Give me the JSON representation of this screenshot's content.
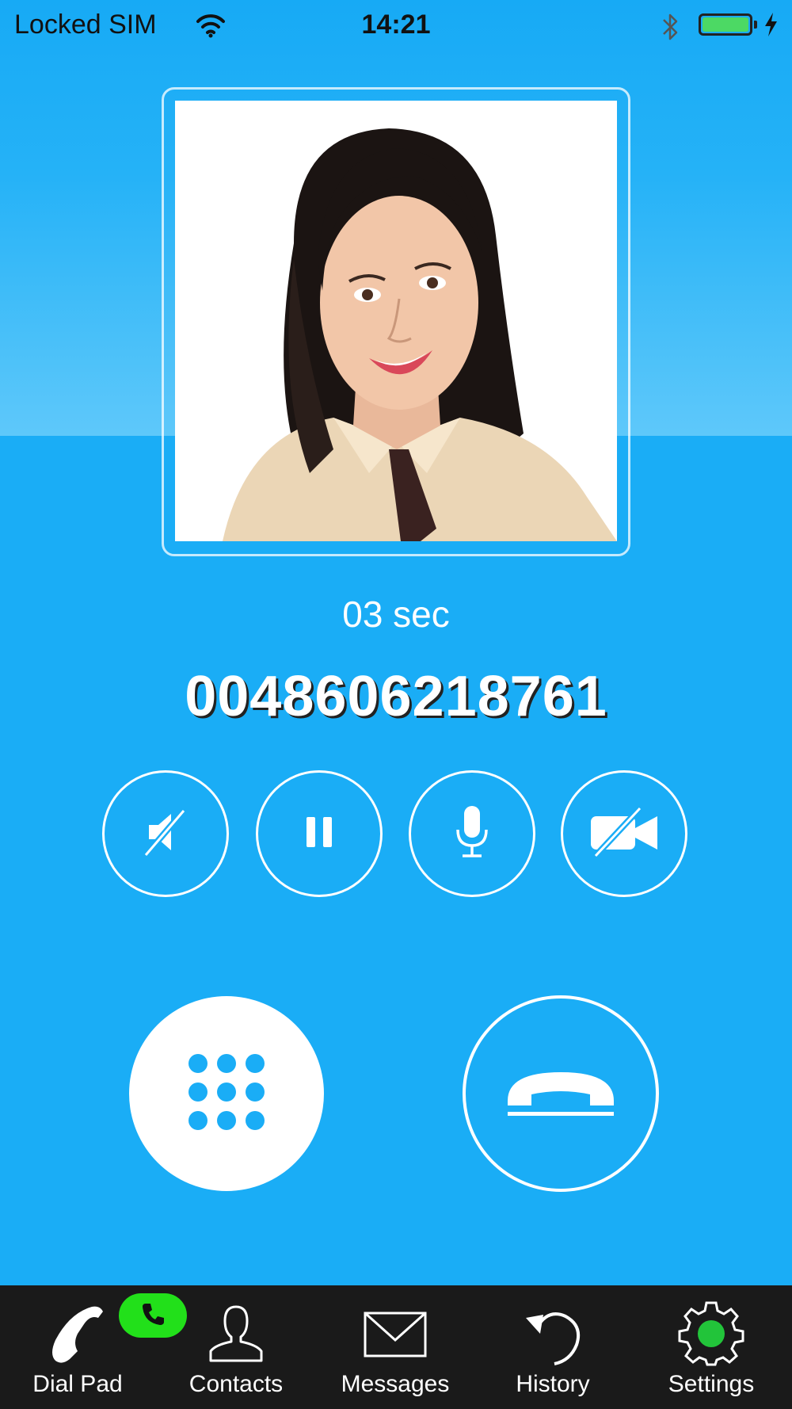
{
  "status_bar": {
    "carrier": "Locked SIM",
    "time": "14:21",
    "battery_level": 1.0,
    "battery_color": "#4CD964"
  },
  "call": {
    "duration": "03 sec",
    "number": "0048606218761"
  },
  "controls": [
    {
      "name": "speaker-mute",
      "icon": "speaker-muted-icon"
    },
    {
      "name": "hold",
      "icon": "pause-icon"
    },
    {
      "name": "microphone",
      "icon": "microphone-icon"
    },
    {
      "name": "video-off",
      "icon": "video-off-icon"
    }
  ],
  "actions": {
    "keypad_icon": "keypad-grid-icon",
    "hangup_icon": "hangup-icon"
  },
  "tabs": [
    {
      "label": "Dial Pad",
      "icon": "phone-handset-icon"
    },
    {
      "label": "Contacts",
      "icon": "person-icon"
    },
    {
      "label": "Messages",
      "icon": "envelope-icon"
    },
    {
      "label": "History",
      "icon": "undo-arrow-icon"
    },
    {
      "label": "Settings",
      "icon": "gear-icon"
    }
  ],
  "colors": {
    "background": "#1AADF6",
    "tab_bar": "#1A1A1A",
    "active_call_badge": "#22E01A",
    "keypad_dots": "#1AADF6"
  }
}
